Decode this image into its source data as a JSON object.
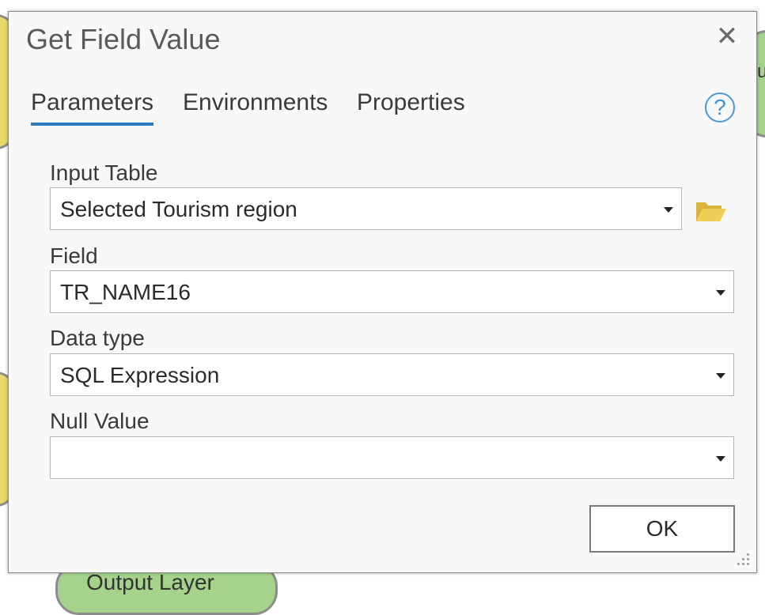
{
  "dialog": {
    "title": "Get Field Value",
    "close_icon": "close-icon"
  },
  "tabs": [
    {
      "label": "Parameters",
      "active": true
    },
    {
      "label": "Environments",
      "active": false
    },
    {
      "label": "Properties",
      "active": false
    }
  ],
  "help_icon": "?",
  "parameters": {
    "input_table": {
      "label": "Input Table",
      "value": "Selected Tourism region"
    },
    "field": {
      "label": "Field",
      "value": "TR_NAME16"
    },
    "data_type": {
      "label": "Data type",
      "value": "SQL Expression"
    },
    "null_value": {
      "label": "Null Value",
      "value": ""
    }
  },
  "buttons": {
    "ok_label": "OK"
  },
  "background": {
    "bottom_node_label": "Output Layer",
    "right_node_label": "u"
  },
  "colors": {
    "tab_underline": "#2a7bbd",
    "help_blue": "#3f93d2",
    "folder_yellow": "#e8c64a",
    "node_yellow": "#e8d96a",
    "node_green": "#a5d38c"
  }
}
